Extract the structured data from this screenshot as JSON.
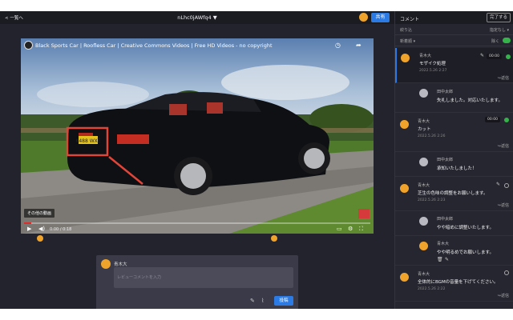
{
  "topbar": {
    "back_label": "< 一覧へ",
    "video_id": "nLhc0jAWfq4 ▼",
    "share_label": "共有"
  },
  "video": {
    "title": "Black Sports Car | Roofless Car | Creative Commons Videos | Free HD Videos - no copyright",
    "more_videos_label": "その他の動画",
    "time": "0:00 / 0:18",
    "progress_fraction": 0.02,
    "plate_text": "K488 WXE",
    "badge_label": "youtube"
  },
  "composer": {
    "user_name": "青木大",
    "placeholder": "レビューコメントを入力",
    "post_label": "投稿"
  },
  "panel": {
    "title": "コメント",
    "done_label": "完了する",
    "filter_left": "絞り込",
    "filter_right": "指定なし ▾",
    "sort_label": "新着順 ▾",
    "toggle_label": "除く",
    "reply_label": "↪返信",
    "comments": [
      {
        "name": "青木大",
        "text": "モザイク処理",
        "date": "2022.5.26 2:27",
        "timecode": "00:00",
        "status": "done"
      },
      {
        "name": "田中太郎",
        "text": "失礼しました。対応いたします。",
        "date": ""
      },
      {
        "name": "青木大",
        "text": "カット",
        "date": "2022.5.26 2:26",
        "timecode": "00:00",
        "status": "done"
      },
      {
        "name": "田中太郎",
        "text": "承知いたしました！",
        "date": ""
      },
      {
        "name": "青木大",
        "text": "芝生の色味の調整をお願いします。",
        "date": "2022.5.26 2:23",
        "status": "open"
      },
      {
        "name": "田中太郎",
        "text": "やや暗めに調整いたします。",
        "date": ""
      },
      {
        "name": "青木大",
        "text": "やや明るめでお願いします。",
        "date": ""
      },
      {
        "name": "青木大",
        "text": "全体的にBGMの音量を下げてください。",
        "date": "2022.5.26 2:22",
        "status": "open"
      }
    ]
  },
  "colors": {
    "accent": "#2c7be5",
    "avatar_orange": "#f0a32a",
    "status_green": "#35b24a",
    "annotation_red": "#e0453a",
    "background": "#23232d"
  },
  "icons": [
    "youtube-logo-icon",
    "clock-icon",
    "share-icon",
    "play-icon",
    "volume-icon",
    "subtitles-icon",
    "settings-icon",
    "fullscreen-icon",
    "pen-icon",
    "paperclip-icon",
    "trash-icon",
    "edit-icon",
    "check-icon"
  ]
}
